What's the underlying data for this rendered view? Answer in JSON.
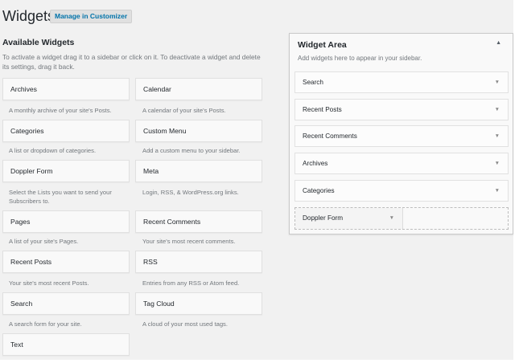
{
  "page": {
    "title": "Widgets",
    "manage_label": "Manage in Customizer"
  },
  "available": {
    "title": "Available Widgets",
    "description": "To activate a widget drag it to a sidebar or click on it. To deactivate a widget and delete its settings, drag it back.",
    "widgets": [
      {
        "name": "Archives",
        "desc": "A monthly archive of your site's Posts."
      },
      {
        "name": "Calendar",
        "desc": "A calendar of your site's Posts."
      },
      {
        "name": "Categories",
        "desc": "A list or dropdown of categories."
      },
      {
        "name": "Custom Menu",
        "desc": "Add a custom menu to your sidebar."
      },
      {
        "name": "Doppler Form",
        "desc": "Select the Lists you want to send your Subscribers to."
      },
      {
        "name": "Meta",
        "desc": "Login, RSS, & WordPress.org links."
      },
      {
        "name": "Pages",
        "desc": "A list of your site's Pages."
      },
      {
        "name": "Recent Comments",
        "desc": "Your site's most recent comments."
      },
      {
        "name": "Recent Posts",
        "desc": "Your site's most recent Posts."
      },
      {
        "name": "RSS",
        "desc": "Entries from any RSS or Atom feed."
      },
      {
        "name": "Search",
        "desc": "A search form for your site."
      },
      {
        "name": "Tag Cloud",
        "desc": "A cloud of your most used tags."
      },
      {
        "name": "Text",
        "desc": ""
      }
    ]
  },
  "sidebar": {
    "title": "Widget Area",
    "description": "Add widgets here to appear in your sidebar.",
    "widgets": [
      "Search",
      "Recent Posts",
      "Recent Comments",
      "Archives",
      "Categories"
    ],
    "dragging": "Doppler Form"
  },
  "icons": {
    "collapse": "triangle-up",
    "expand": "triangle-down"
  },
  "colors": {
    "link": "#0073aa",
    "background": "#f1f1f1"
  }
}
